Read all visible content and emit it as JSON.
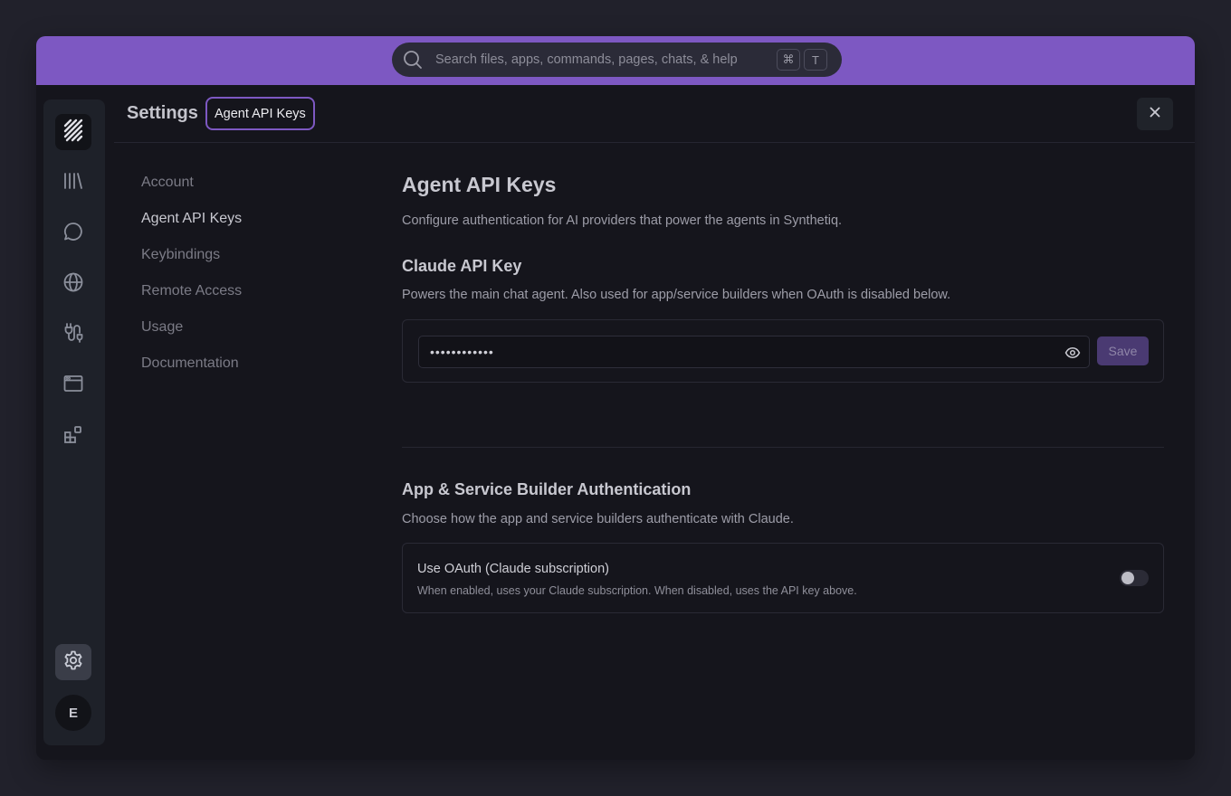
{
  "search": {
    "placeholder": "Search files, apps, commands, pages, chats, & help",
    "shortcut": [
      "⌘",
      "T"
    ]
  },
  "rail": {
    "items": [
      {
        "name": "logo",
        "icon": "stack-logo-icon"
      },
      {
        "name": "library",
        "icon": "library-icon"
      },
      {
        "name": "chats",
        "icon": "chat-bubble-icon"
      },
      {
        "name": "web",
        "icon": "globe-icon"
      },
      {
        "name": "services",
        "icon": "plug-icon"
      },
      {
        "name": "apps",
        "icon": "window-icon"
      },
      {
        "name": "widgets",
        "icon": "widgets-icon"
      },
      {
        "name": "settings",
        "icon": "gear-icon",
        "active": true
      }
    ],
    "avatar_initial": "E"
  },
  "header": {
    "title": "Settings",
    "chip": "Agent API Keys"
  },
  "nav": {
    "items": [
      "Account",
      "Agent API Keys",
      "Keybindings",
      "Remote Access",
      "Usage",
      "Documentation"
    ],
    "active_index": 1
  },
  "content": {
    "title": "Agent API Keys",
    "description": "Configure authentication for AI providers that power the agents in Synthetiq.",
    "claude": {
      "title": "Claude API Key",
      "description": "Powers the main chat agent. Also used for app/service builders when OAuth is disabled below.",
      "masked_value": "••••••••••••",
      "save_label": "Save"
    },
    "auth": {
      "title": "App & Service Builder Authentication",
      "description": "Choose how the app and service builders authenticate with Claude.",
      "oauth_label": "Use OAuth (Claude subscription)",
      "oauth_description": "When enabled, uses your Claude subscription. When disabled, uses the API key above.",
      "oauth_enabled": false
    }
  },
  "colors": {
    "accent": "#7d58c2",
    "background": "#15151c",
    "rail": "#1e2129",
    "save_button": "#4a3a72"
  }
}
